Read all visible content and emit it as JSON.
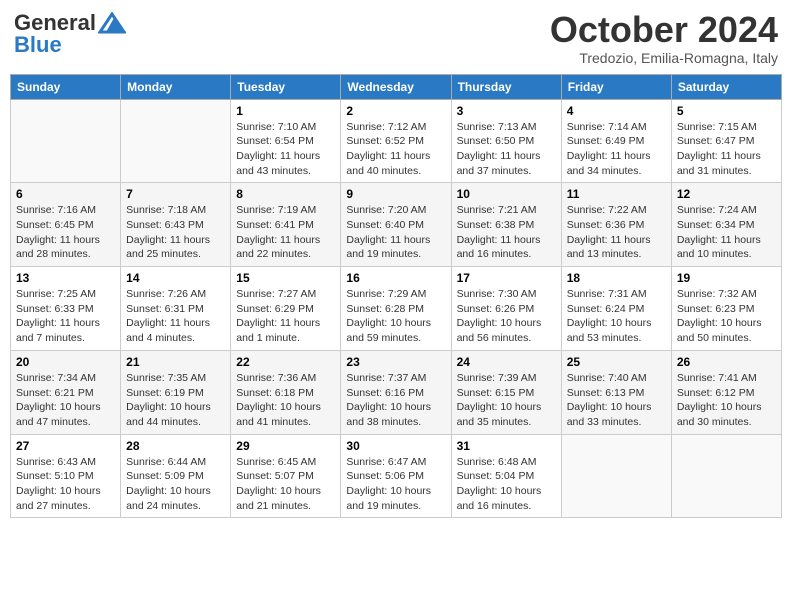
{
  "header": {
    "logo_general": "General",
    "logo_blue": "Blue",
    "month": "October 2024",
    "location": "Tredozio, Emilia-Romagna, Italy"
  },
  "weekdays": [
    "Sunday",
    "Monday",
    "Tuesday",
    "Wednesday",
    "Thursday",
    "Friday",
    "Saturday"
  ],
  "weeks": [
    [
      {
        "day": "",
        "detail": ""
      },
      {
        "day": "",
        "detail": ""
      },
      {
        "day": "1",
        "detail": "Sunrise: 7:10 AM\nSunset: 6:54 PM\nDaylight: 11 hours\nand 43 minutes."
      },
      {
        "day": "2",
        "detail": "Sunrise: 7:12 AM\nSunset: 6:52 PM\nDaylight: 11 hours\nand 40 minutes."
      },
      {
        "day": "3",
        "detail": "Sunrise: 7:13 AM\nSunset: 6:50 PM\nDaylight: 11 hours\nand 37 minutes."
      },
      {
        "day": "4",
        "detail": "Sunrise: 7:14 AM\nSunset: 6:49 PM\nDaylight: 11 hours\nand 34 minutes."
      },
      {
        "day": "5",
        "detail": "Sunrise: 7:15 AM\nSunset: 6:47 PM\nDaylight: 11 hours\nand 31 minutes."
      }
    ],
    [
      {
        "day": "6",
        "detail": "Sunrise: 7:16 AM\nSunset: 6:45 PM\nDaylight: 11 hours\nand 28 minutes."
      },
      {
        "day": "7",
        "detail": "Sunrise: 7:18 AM\nSunset: 6:43 PM\nDaylight: 11 hours\nand 25 minutes."
      },
      {
        "day": "8",
        "detail": "Sunrise: 7:19 AM\nSunset: 6:41 PM\nDaylight: 11 hours\nand 22 minutes."
      },
      {
        "day": "9",
        "detail": "Sunrise: 7:20 AM\nSunset: 6:40 PM\nDaylight: 11 hours\nand 19 minutes."
      },
      {
        "day": "10",
        "detail": "Sunrise: 7:21 AM\nSunset: 6:38 PM\nDaylight: 11 hours\nand 16 minutes."
      },
      {
        "day": "11",
        "detail": "Sunrise: 7:22 AM\nSunset: 6:36 PM\nDaylight: 11 hours\nand 13 minutes."
      },
      {
        "day": "12",
        "detail": "Sunrise: 7:24 AM\nSunset: 6:34 PM\nDaylight: 11 hours\nand 10 minutes."
      }
    ],
    [
      {
        "day": "13",
        "detail": "Sunrise: 7:25 AM\nSunset: 6:33 PM\nDaylight: 11 hours\nand 7 minutes."
      },
      {
        "day": "14",
        "detail": "Sunrise: 7:26 AM\nSunset: 6:31 PM\nDaylight: 11 hours\nand 4 minutes."
      },
      {
        "day": "15",
        "detail": "Sunrise: 7:27 AM\nSunset: 6:29 PM\nDaylight: 11 hours\nand 1 minute."
      },
      {
        "day": "16",
        "detail": "Sunrise: 7:29 AM\nSunset: 6:28 PM\nDaylight: 10 hours\nand 59 minutes."
      },
      {
        "day": "17",
        "detail": "Sunrise: 7:30 AM\nSunset: 6:26 PM\nDaylight: 10 hours\nand 56 minutes."
      },
      {
        "day": "18",
        "detail": "Sunrise: 7:31 AM\nSunset: 6:24 PM\nDaylight: 10 hours\nand 53 minutes."
      },
      {
        "day": "19",
        "detail": "Sunrise: 7:32 AM\nSunset: 6:23 PM\nDaylight: 10 hours\nand 50 minutes."
      }
    ],
    [
      {
        "day": "20",
        "detail": "Sunrise: 7:34 AM\nSunset: 6:21 PM\nDaylight: 10 hours\nand 47 minutes."
      },
      {
        "day": "21",
        "detail": "Sunrise: 7:35 AM\nSunset: 6:19 PM\nDaylight: 10 hours\nand 44 minutes."
      },
      {
        "day": "22",
        "detail": "Sunrise: 7:36 AM\nSunset: 6:18 PM\nDaylight: 10 hours\nand 41 minutes."
      },
      {
        "day": "23",
        "detail": "Sunrise: 7:37 AM\nSunset: 6:16 PM\nDaylight: 10 hours\nand 38 minutes."
      },
      {
        "day": "24",
        "detail": "Sunrise: 7:39 AM\nSunset: 6:15 PM\nDaylight: 10 hours\nand 35 minutes."
      },
      {
        "day": "25",
        "detail": "Sunrise: 7:40 AM\nSunset: 6:13 PM\nDaylight: 10 hours\nand 33 minutes."
      },
      {
        "day": "26",
        "detail": "Sunrise: 7:41 AM\nSunset: 6:12 PM\nDaylight: 10 hours\nand 30 minutes."
      }
    ],
    [
      {
        "day": "27",
        "detail": "Sunrise: 6:43 AM\nSunset: 5:10 PM\nDaylight: 10 hours\nand 27 minutes."
      },
      {
        "day": "28",
        "detail": "Sunrise: 6:44 AM\nSunset: 5:09 PM\nDaylight: 10 hours\nand 24 minutes."
      },
      {
        "day": "29",
        "detail": "Sunrise: 6:45 AM\nSunset: 5:07 PM\nDaylight: 10 hours\nand 21 minutes."
      },
      {
        "day": "30",
        "detail": "Sunrise: 6:47 AM\nSunset: 5:06 PM\nDaylight: 10 hours\nand 19 minutes."
      },
      {
        "day": "31",
        "detail": "Sunrise: 6:48 AM\nSunset: 5:04 PM\nDaylight: 10 hours\nand 16 minutes."
      },
      {
        "day": "",
        "detail": ""
      },
      {
        "day": "",
        "detail": ""
      }
    ]
  ]
}
